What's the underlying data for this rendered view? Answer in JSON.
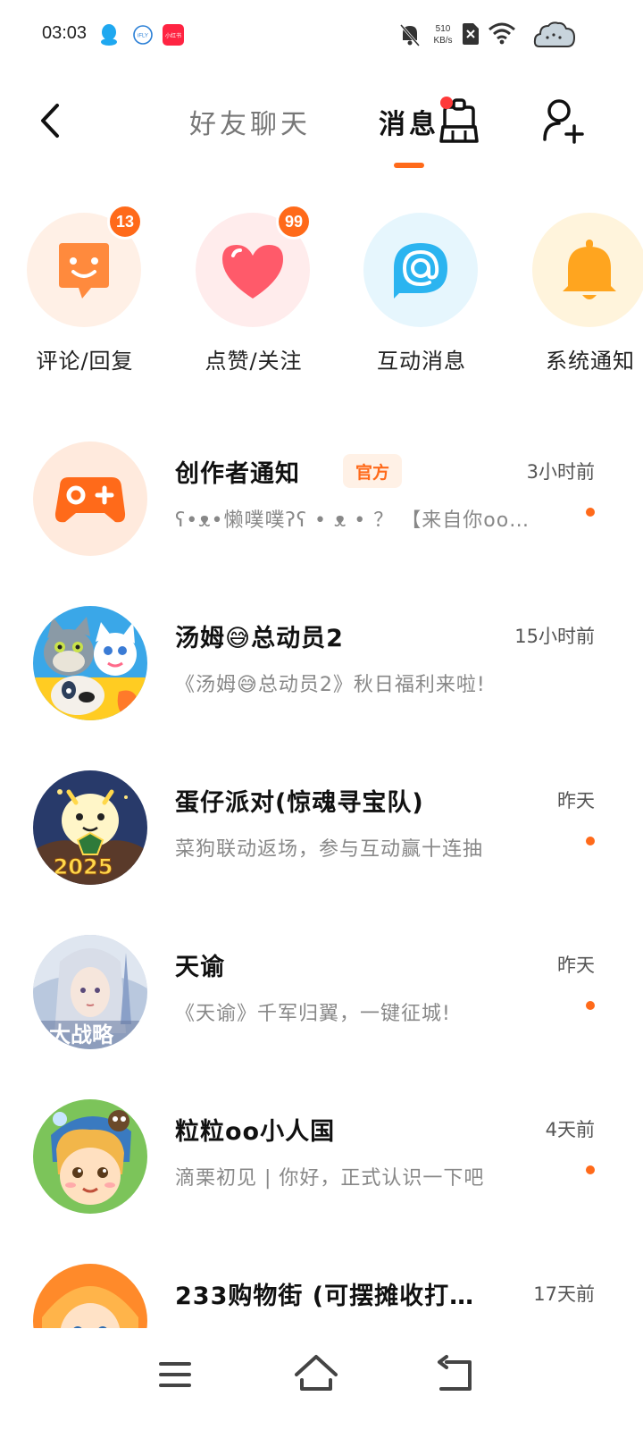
{
  "status_bar": {
    "time": "03:03",
    "network_speed_value": "510",
    "network_speed_unit": "KB/s",
    "apps": [
      "qq-icon",
      "ifly-icon",
      "xiaohongshu-icon"
    ],
    "app_text": {
      "ifly": "iFLY",
      "xhs": "小红书"
    }
  },
  "header": {
    "tabs": [
      {
        "label": "好友聊天",
        "active": false
      },
      {
        "label": "消息",
        "active": true
      }
    ],
    "accent": "#ff6a1a"
  },
  "categories": [
    {
      "label": "评论/回复",
      "badge": "13",
      "icon": "comment-smile-icon",
      "bg": "#fff0e6"
    },
    {
      "label": "点赞/关注",
      "badge": "99",
      "icon": "heart-icon",
      "bg": "#ffecec"
    },
    {
      "label": "互动消息",
      "badge": "",
      "icon": "at-sign-icon",
      "bg": "#e6f6fd"
    },
    {
      "label": "系统通知",
      "badge": "",
      "icon": "bell-icon",
      "bg": "#fff4dc"
    }
  ],
  "conversations": [
    {
      "name": "创作者通知",
      "tag": "官方",
      "time": "3小时前",
      "preview": "ʕ•ᴥ•懒噗噗ʔʕ • ᴥ • ？ 【来自你oo…",
      "unread": true,
      "avatar": "gamepad-icon"
    },
    {
      "name": "汤姆😅总动员2",
      "tag": "",
      "time": "15小时前",
      "preview": "《汤姆😅总动员2》秋日福利来啦!",
      "unread": false,
      "avatar": "talking-tom-avatar"
    },
    {
      "name": "蛋仔派对(惊魂寻宝队)",
      "tag": "",
      "time": "昨天",
      "preview": "菜狗联动返场，参与互动赢十连抽",
      "unread": true,
      "avatar": "eggy-party-avatar",
      "avatar_text": "2025"
    },
    {
      "name": "天谕",
      "tag": "",
      "time": "昨天",
      "preview": "《天谕》千军归翼，一键征城!",
      "unread": true,
      "avatar": "tianyu-avatar",
      "avatar_text": "大战略"
    },
    {
      "name": "粒粒oo小人国",
      "tag": "",
      "time": "4天前",
      "preview": "滴栗初见 | 你好，正式认识一下吧",
      "unread": true,
      "avatar": "lili-avatar"
    },
    {
      "name": "233购物街 (可摆摊收打…",
      "tag": "",
      "time": "17天前",
      "preview": "",
      "unread": false,
      "avatar": "shopping-street-avatar"
    }
  ]
}
